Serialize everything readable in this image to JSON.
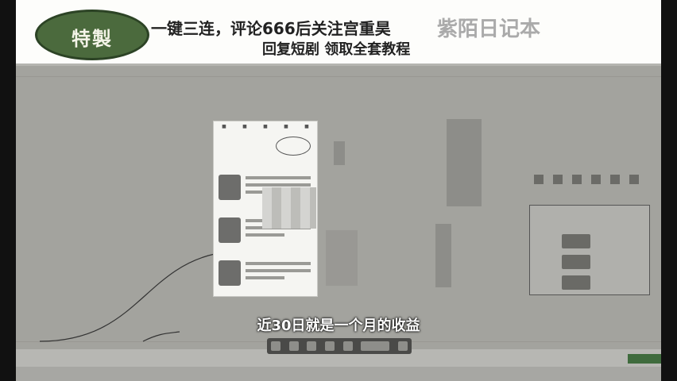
{
  "banner": {
    "badge": "特製",
    "line1": "一键三连，评论666后关注宫重昊",
    "line2": "回复短剧  领取全套教程",
    "watermark": "紫陌日记本"
  },
  "subtitle": "近30日就是一个月的收益",
  "icons": {
    "badge": "oval-seal",
    "toolbar": [
      "chevron-left-icon",
      "settings-icon",
      "zoom-icon",
      "fit-icon",
      "download-icon",
      "more-icon",
      "chevron-right-icon"
    ]
  }
}
